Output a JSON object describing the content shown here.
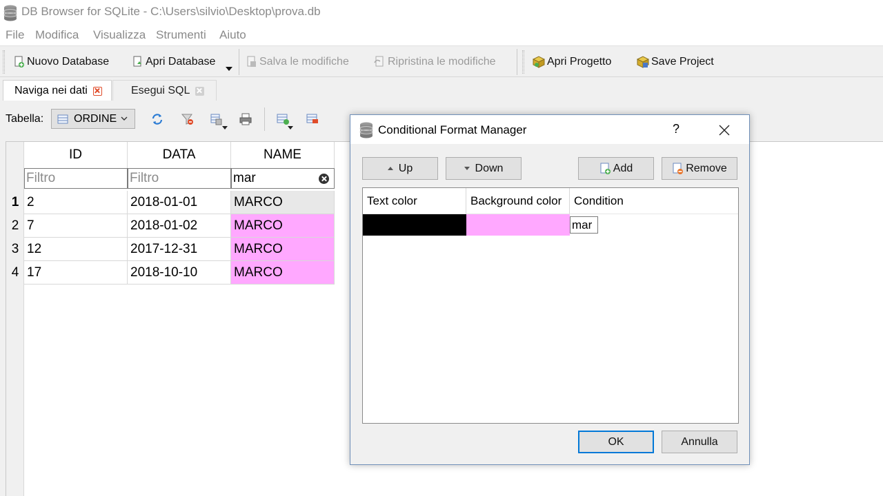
{
  "window": {
    "title": "DB Browser for SQLite - C:\\Users\\silvio\\Desktop\\prova.db"
  },
  "menu": [
    "File",
    "Modifica",
    "Visualizza",
    "Strumenti",
    "Aiuto"
  ],
  "toolbar": {
    "new_db": "Nuovo Database",
    "open_db": "Apri Database",
    "save_changes": "Salva le modifiche",
    "revert_changes": "Ripristina le modifiche",
    "open_project": "Apri Progetto",
    "save_project": "Save Project"
  },
  "tabs": [
    {
      "label": "Naviga nei dati",
      "active": true
    },
    {
      "label": "Esegui SQL",
      "active": false
    }
  ],
  "browse": {
    "table_label": "Tabella:",
    "selected_table": "ORDINE",
    "columns": [
      "ID",
      "DATA",
      "NAME"
    ],
    "filters": [
      {
        "placeholder": "Filtro",
        "value": ""
      },
      {
        "placeholder": "Filtro",
        "value": ""
      },
      {
        "placeholder": "Filtro",
        "value": "mar"
      }
    ],
    "rows": [
      {
        "num": "1",
        "id": "2",
        "data": "2018-01-01",
        "name": "MARCO",
        "highlight": false
      },
      {
        "num": "2",
        "id": "7",
        "data": "2018-01-02",
        "name": "MARCO",
        "highlight": true
      },
      {
        "num": "3",
        "id": "12",
        "data": "2017-12-31",
        "name": "MARCO",
        "highlight": true
      },
      {
        "num": "4",
        "id": "17",
        "data": "2018-10-10",
        "name": "MARCO",
        "highlight": true
      }
    ],
    "highlight_color": "#ffa8ff",
    "selected_color": "#e8e8e8"
  },
  "dialog": {
    "title": "Conditional Format Manager",
    "help": "?",
    "up": "Up",
    "down": "Down",
    "add": "Add",
    "remove": "Remove",
    "columns": [
      "Text color",
      "Background color",
      "Condition"
    ],
    "formats": [
      {
        "text_color": "#000000",
        "background_color": "#ffa8ff",
        "condition": "mar"
      }
    ],
    "ok": "OK",
    "cancel": "Annulla"
  }
}
